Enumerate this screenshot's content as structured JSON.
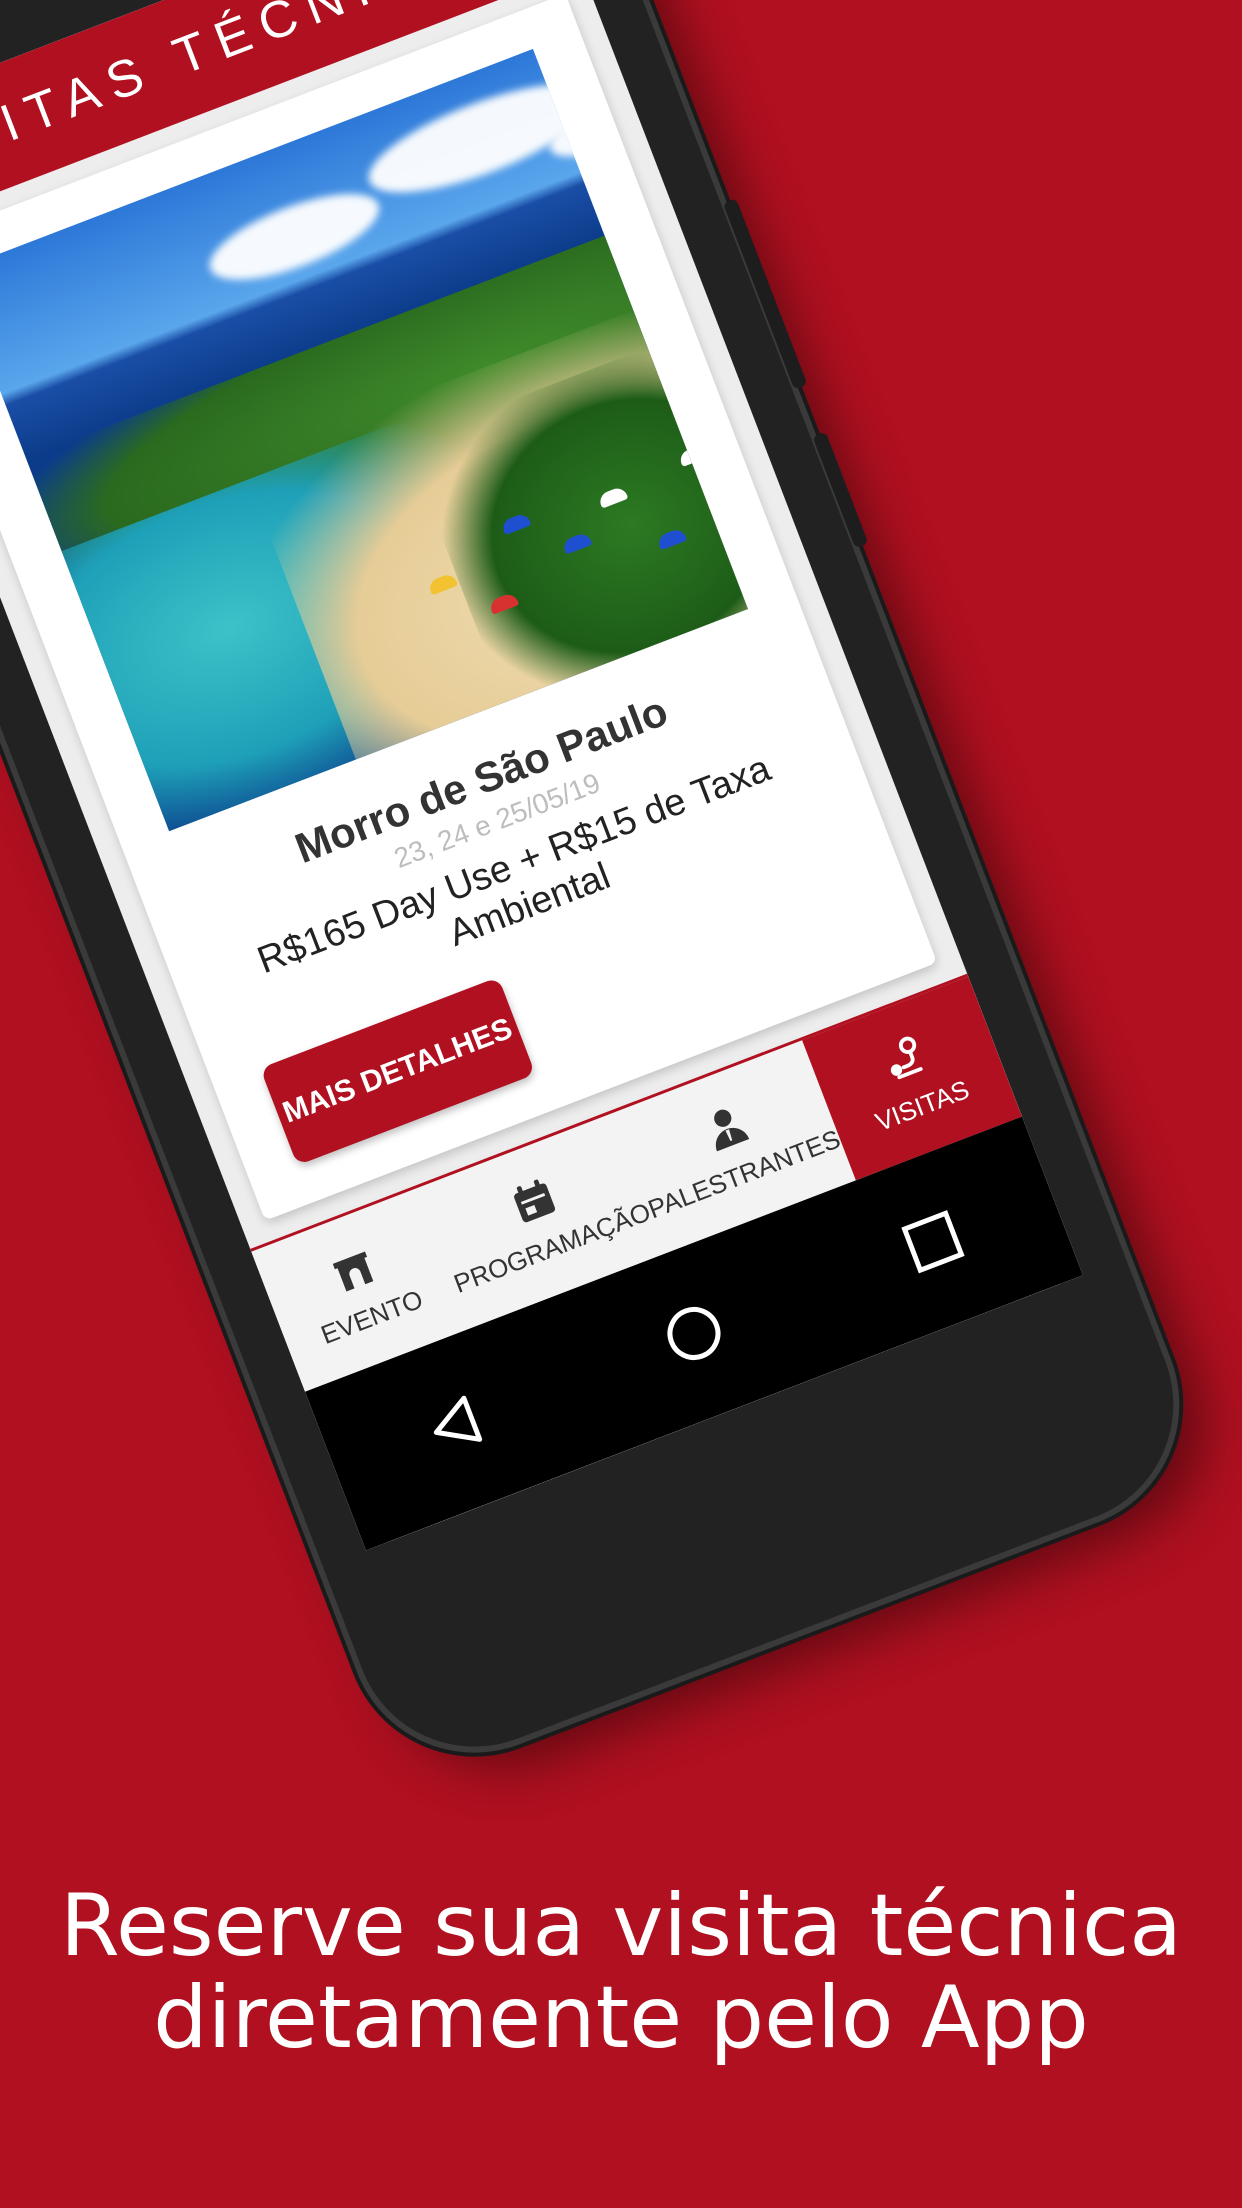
{
  "colors": {
    "brand_red": "#b01020",
    "background": "#b01020",
    "text_dark": "#333333",
    "date_gray": "#bdbdbd"
  },
  "app": {
    "header_title": "VISITAS TÉCNICAS"
  },
  "card": {
    "image_icon": "beach-photo",
    "title": "Morro de São Paulo",
    "date": "23, 24 e 25/05/19",
    "price": "R$165 Day Use + R$15 de Taxa Ambiental",
    "button_label": "MAIS DETALHES"
  },
  "bottom_nav": {
    "items": [
      {
        "label": "EVENTO",
        "icon": "arch-icon",
        "active": false
      },
      {
        "label": "PROGRAMAÇÃO",
        "icon": "calendar-icon",
        "active": false
      },
      {
        "label": "PALESTRANTES",
        "icon": "speaker-icon",
        "active": false
      },
      {
        "label": "VISITAS",
        "icon": "route-pin-icon",
        "active": true
      }
    ]
  },
  "system_nav": {
    "back": "back-triangle-icon",
    "home": "home-circle-icon",
    "recents": "recents-square-icon"
  },
  "promo": {
    "line1": "Reserve sua visita técnica",
    "line2": "diretamente pelo App"
  }
}
